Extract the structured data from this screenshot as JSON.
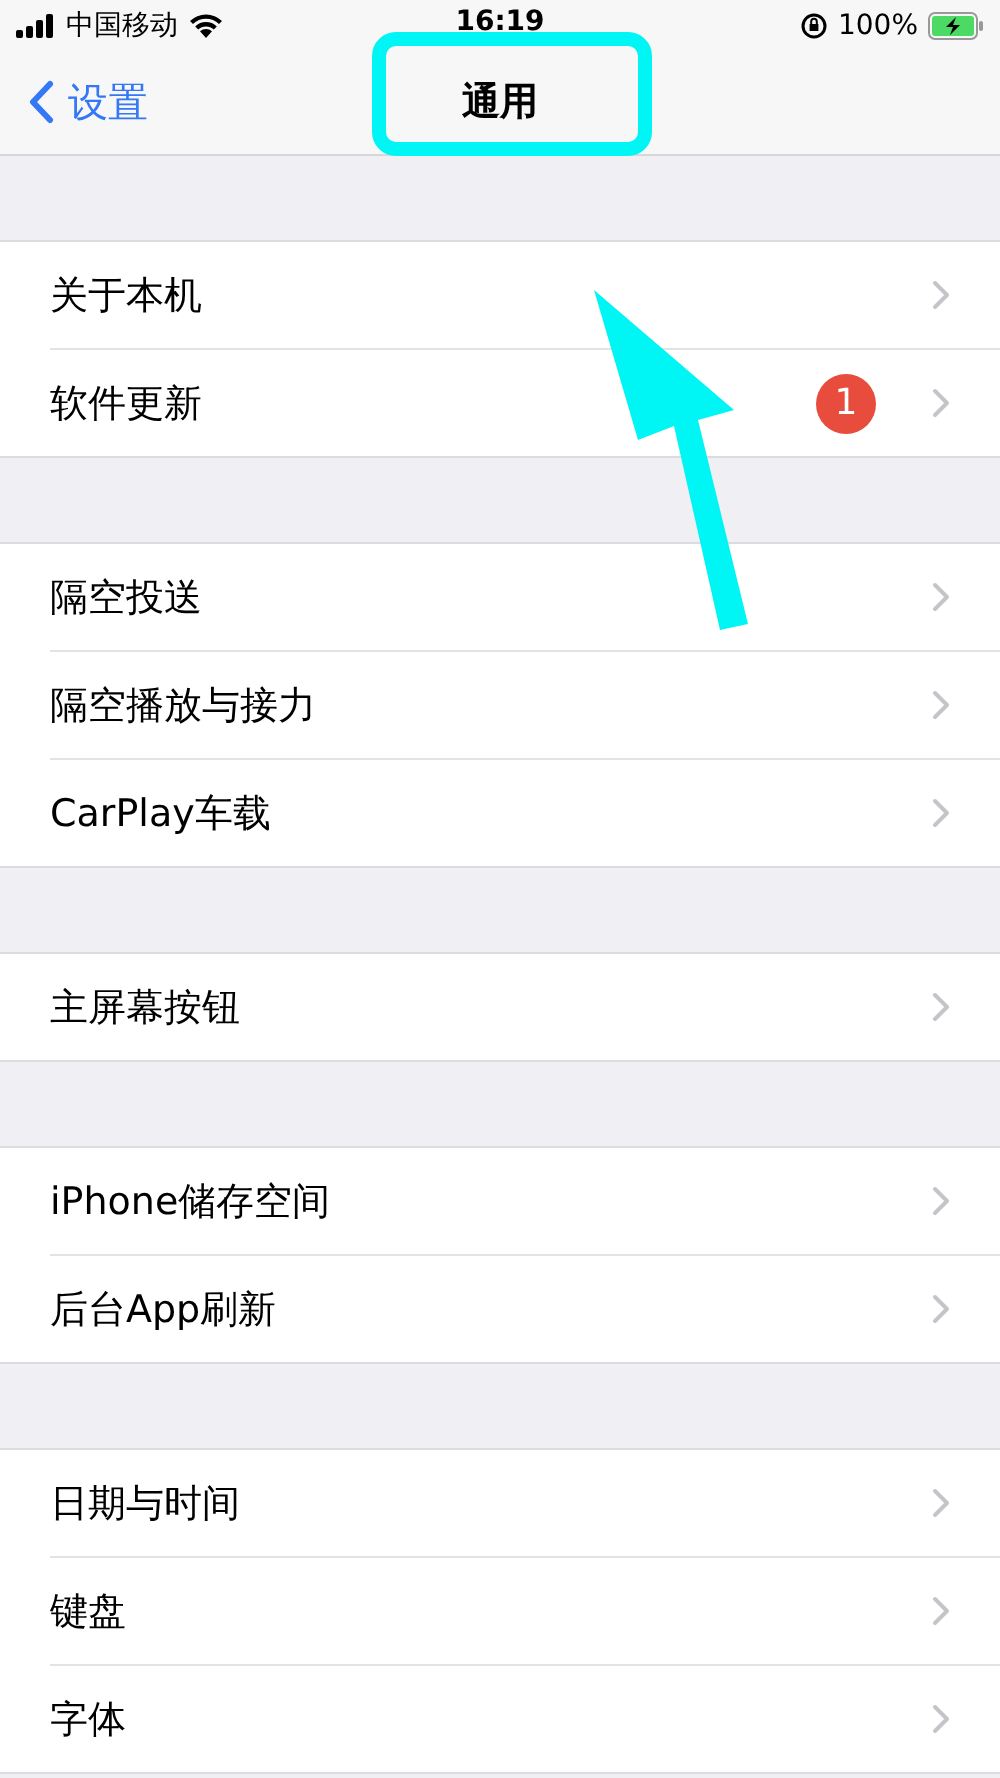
{
  "status_bar": {
    "carrier": "中国移动",
    "time": "16:19",
    "battery": "100%",
    "charging": true
  },
  "nav": {
    "back": "设置",
    "title": "通用"
  },
  "groups": [
    {
      "items": [
        {
          "label": "关于本机"
        },
        {
          "label": "软件更新",
          "badge": "1"
        }
      ]
    },
    {
      "items": [
        {
          "label": "隔空投送"
        },
        {
          "label": "隔空播放与接力"
        },
        {
          "label": "CarPlay车载"
        }
      ]
    },
    {
      "items": [
        {
          "label": "主屏幕按钮"
        }
      ]
    },
    {
      "items": [
        {
          "label": "iPhone储存空间"
        },
        {
          "label": "后台App刷新"
        }
      ]
    },
    {
      "items": [
        {
          "label": "日期与时间"
        },
        {
          "label": "键盘"
        },
        {
          "label": "字体"
        }
      ]
    }
  ],
  "annotations": {
    "highlight_box": true,
    "arrow": true
  }
}
